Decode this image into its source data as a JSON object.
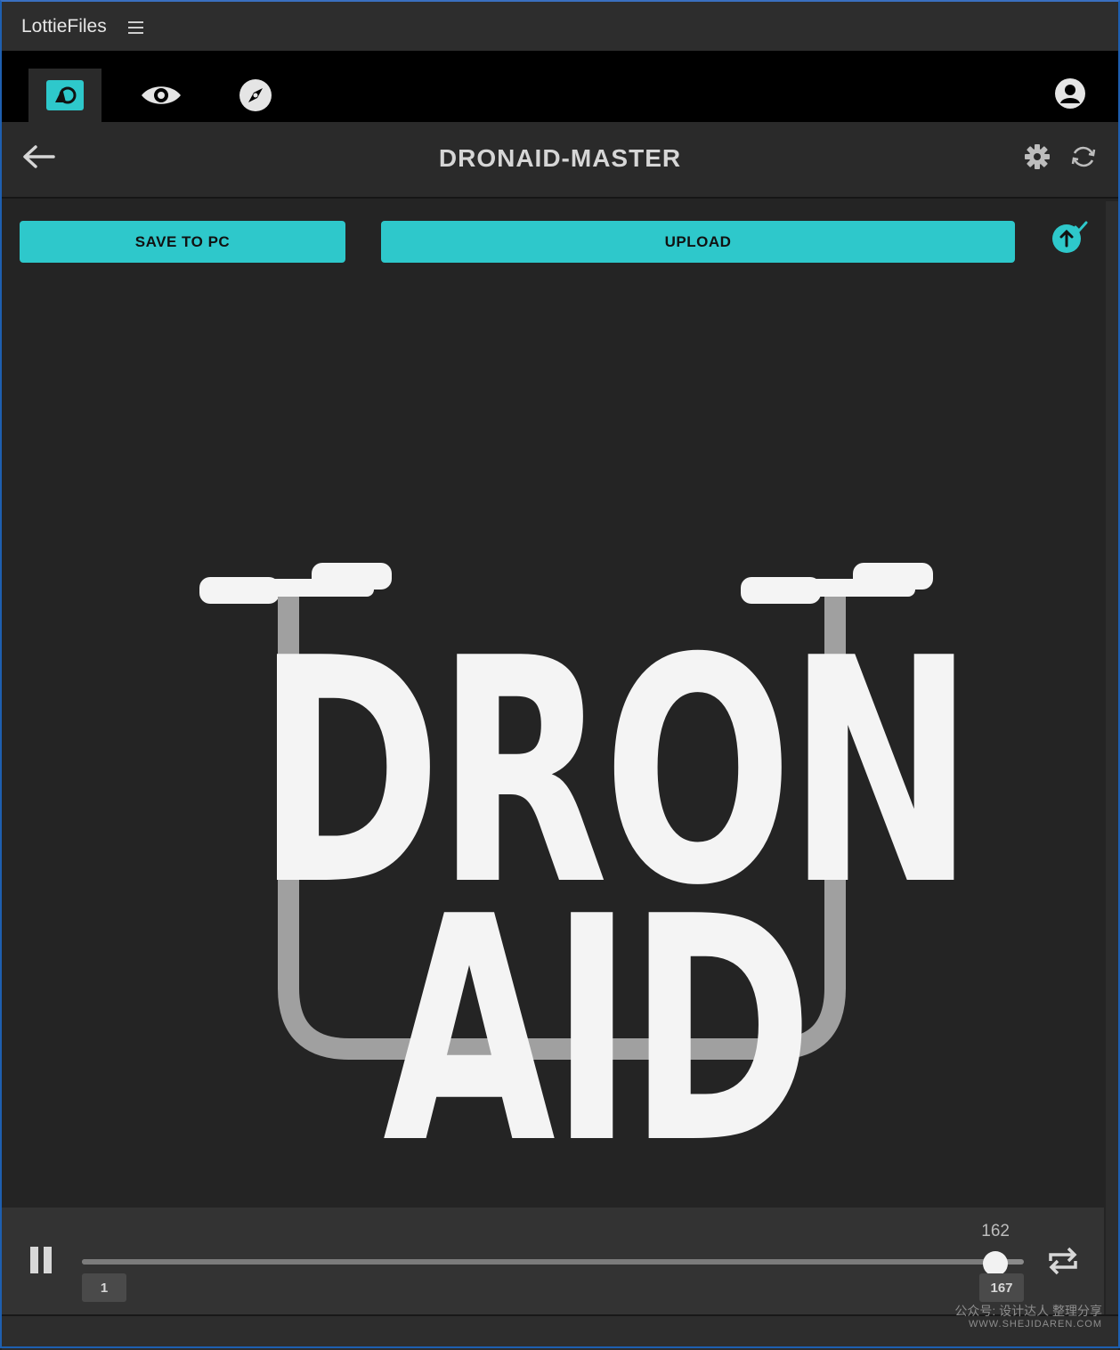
{
  "window": {
    "title": "LottieFiles"
  },
  "tabs": [
    {
      "name": "plugin",
      "active": true
    },
    {
      "name": "preview",
      "active": false
    },
    {
      "name": "explore",
      "active": false
    }
  ],
  "header": {
    "title": "DRONAID-MASTER"
  },
  "actions": {
    "save_label": "SAVE TO PC",
    "upload_label": "UPLOAD"
  },
  "preview": {
    "line1": "DRON",
    "line2": "AID"
  },
  "player": {
    "current_frame": "162",
    "start_frame": "1",
    "end_frame": "167",
    "progress": 0.97,
    "state": "playing"
  },
  "watermark": {
    "line1": "公众号: 设计达人 整理分享",
    "line2": "WWW.SHEJIDAREN.COM"
  },
  "colors": {
    "accent": "#2ec8cb",
    "background": "#242424",
    "tabbar": "#000000"
  },
  "icons": [
    "menu-icon",
    "lottie-logo-icon",
    "eye-icon",
    "compass-icon",
    "user-icon",
    "back-arrow-icon",
    "gear-icon",
    "refresh-icon",
    "upload-check-icon",
    "pause-icon",
    "loop-icon"
  ]
}
